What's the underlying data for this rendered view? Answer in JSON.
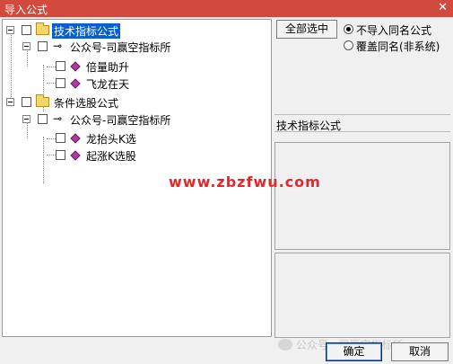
{
  "window": {
    "title": "导入公式",
    "close_glyph": "✕"
  },
  "tree": {
    "groups": [
      {
        "label": "技术指标公式",
        "selected": true,
        "authors": [
          {
            "label": "公众号-司赢空指标所",
            "formulas": [
              "倍量助升",
              "飞龙在天"
            ]
          }
        ]
      },
      {
        "label": "条件选股公式",
        "selected": false,
        "authors": [
          {
            "label": "公众号-司赢空指标所",
            "formulas": [
              "龙抬头K选",
              "起涨K选股"
            ]
          }
        ]
      }
    ],
    "icons": {
      "group": "folder-icon",
      "author": "key-icon",
      "formula": "formula-diamond-icon"
    }
  },
  "options": {
    "select_all_label": "全部选中",
    "radios": [
      {
        "label": "不导入同名公式",
        "checked": true
      },
      {
        "label": "覆盖同名(非系统)",
        "checked": false
      }
    ]
  },
  "current_name": "技术指标公式",
  "footer": {
    "ok_label": "确定",
    "cancel_label": "取消"
  },
  "overlay": {
    "watermark": "www.zbzfwu.com",
    "wechat_text": "公众号 · 司赢空指标所"
  },
  "colors": {
    "titlebar": "#d24a3e",
    "selection": "#0a5fcf",
    "watermark": "#e8252a"
  }
}
